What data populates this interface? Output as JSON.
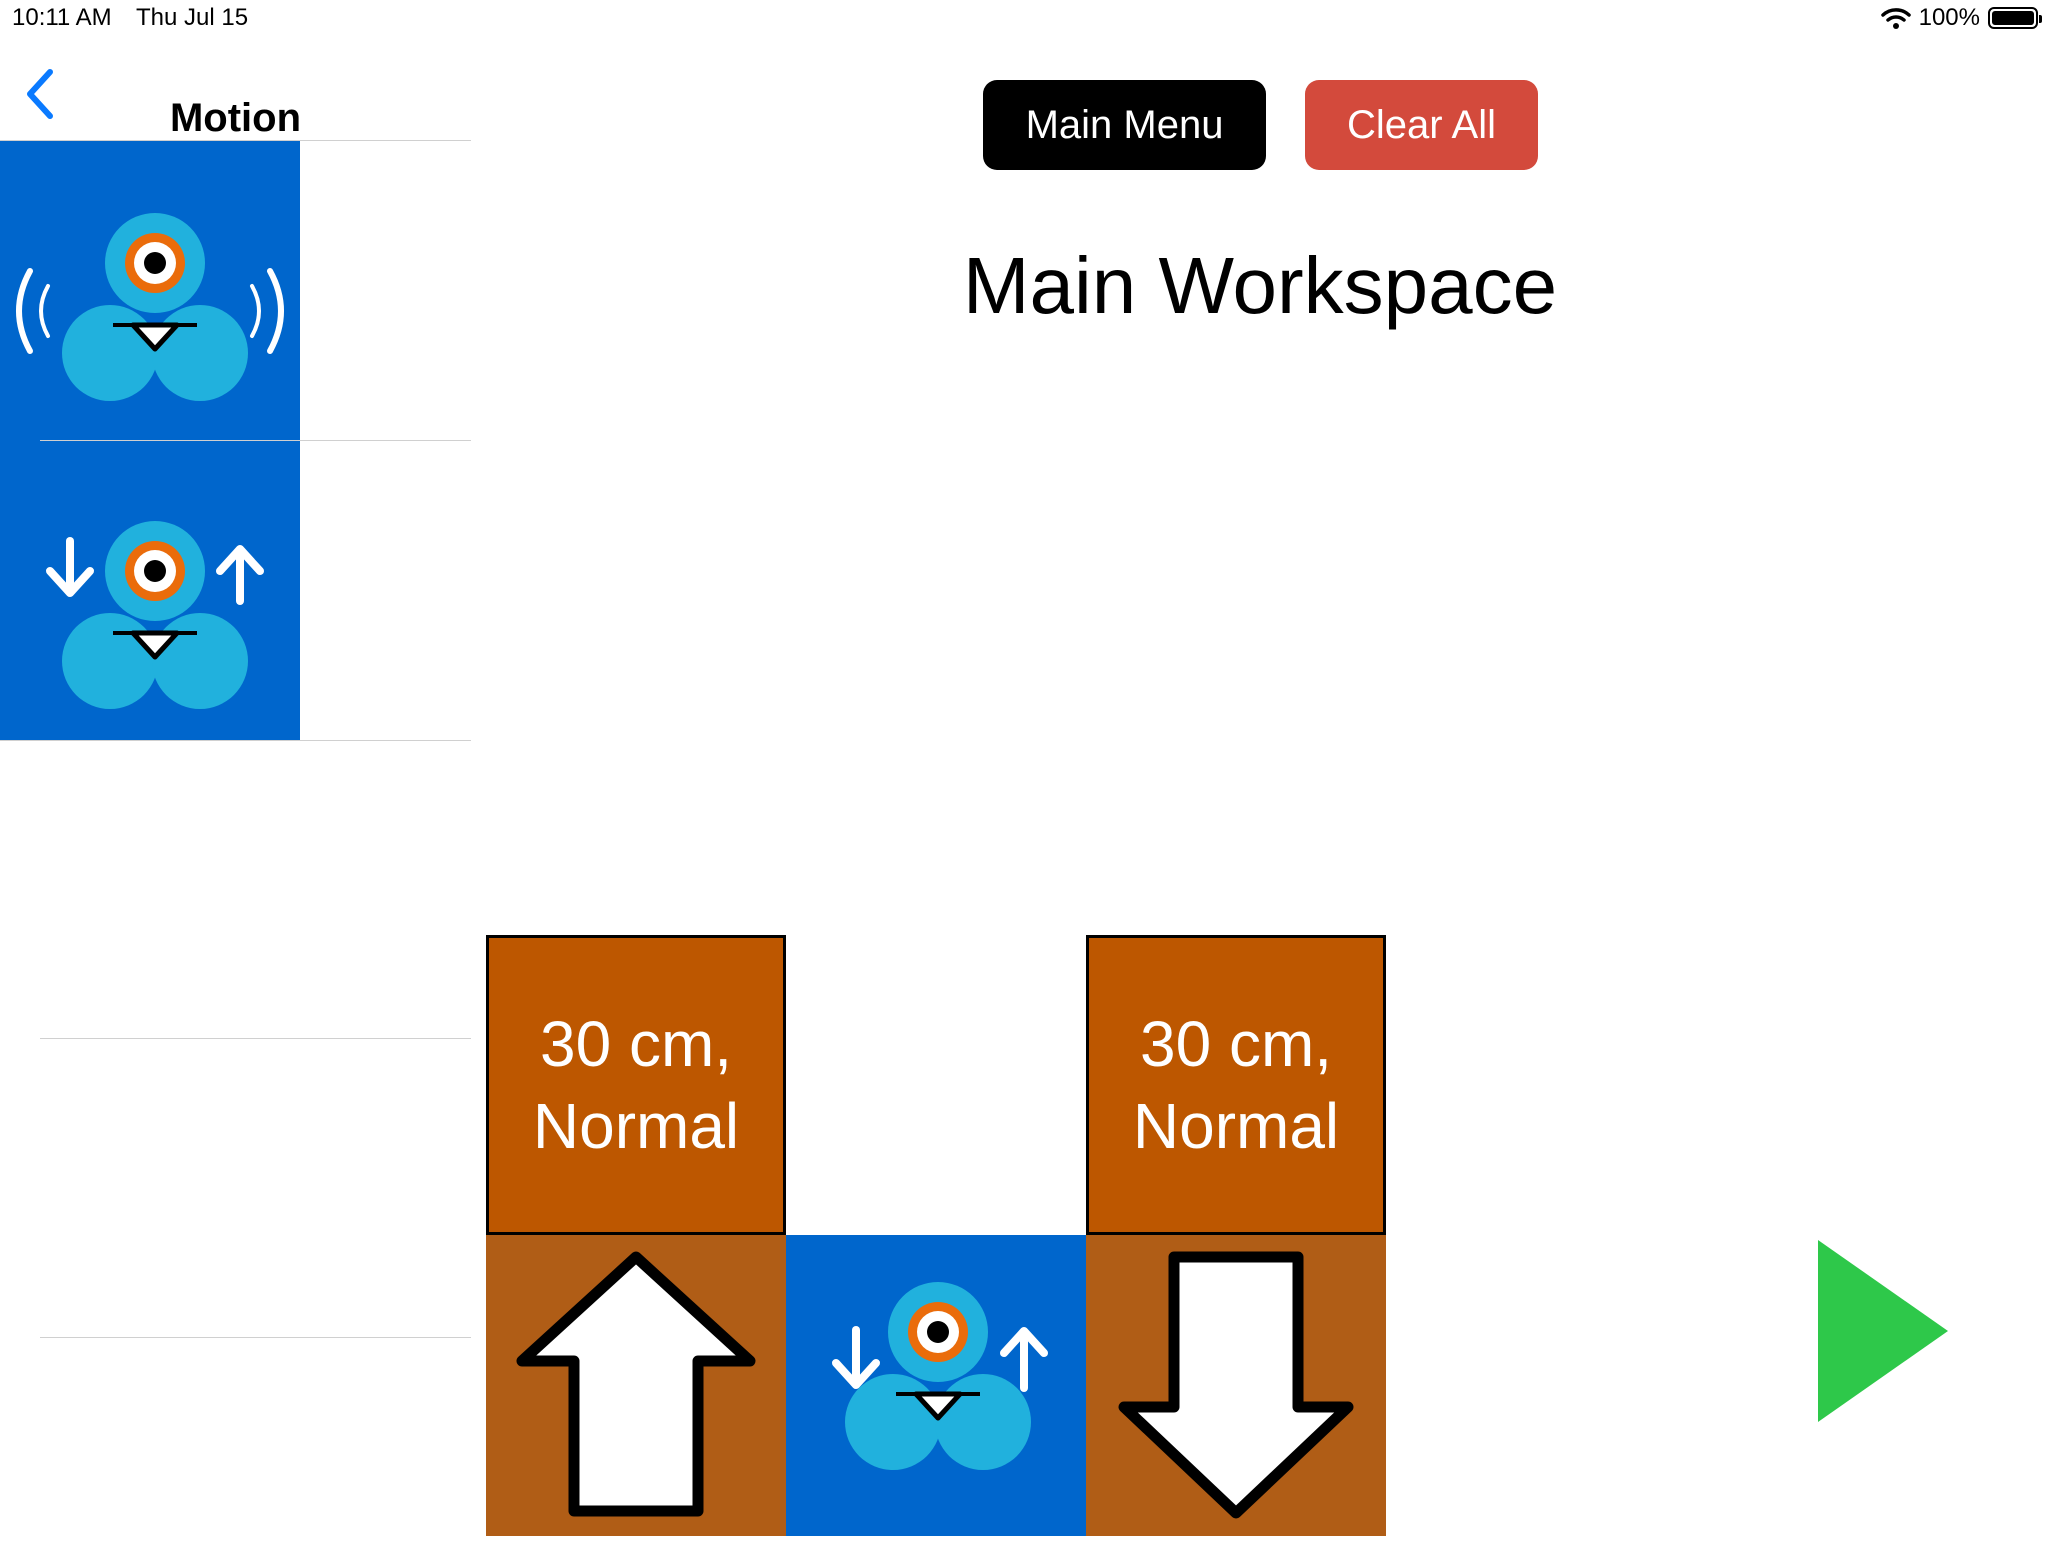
{
  "status_bar": {
    "time": "10:11 AM",
    "date": "Thu Jul 15",
    "battery_percent": "100%"
  },
  "sidebar": {
    "title": "Motion",
    "items": [
      {
        "name": "wiggle-block",
        "icon": "dash-robot-wiggle-icon"
      },
      {
        "name": "move-block",
        "icon": "dash-robot-move-icon"
      }
    ]
  },
  "toolbar": {
    "main_menu_label": "Main Menu",
    "clear_all_label": "Clear All"
  },
  "workspace": {
    "title": "Main Workspace",
    "program": [
      {
        "line1": "30 cm,",
        "line2": "Normal",
        "direction": "up"
      },
      {
        "icon": "dash-robot-move-icon"
      },
      {
        "line1": "30 cm,",
        "line2": "Normal",
        "direction": "down"
      }
    ]
  },
  "colors": {
    "accent": "#0066cc",
    "clear_button": "#d34a3c",
    "param_block": "#bd5700",
    "arrow_block": "#b05d16",
    "play": "#2ec84a",
    "robot": "#21b1dd",
    "robot_eye_ring": "#ea6c0b"
  },
  "icons": {
    "back": "chevron-left-icon",
    "play": "play-icon",
    "wifi": "wifi-icon",
    "battery": "battery-icon"
  }
}
